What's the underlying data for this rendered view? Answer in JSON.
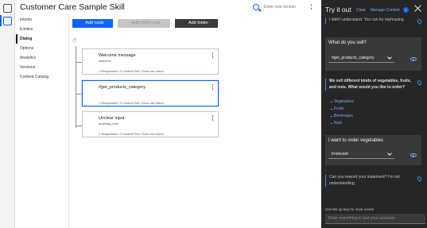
{
  "app": {
    "title": "Customer Care Sample Skill"
  },
  "header": {
    "version_placeholder": "Enter new version"
  },
  "nav": {
    "items": [
      {
        "label": "Intents"
      },
      {
        "label": "Entities"
      },
      {
        "label": "Dialog",
        "active": true
      },
      {
        "label": "Options"
      },
      {
        "label": "Analytics"
      },
      {
        "label": "Versions"
      },
      {
        "label": "Content Catalog"
      }
    ]
  },
  "toolbar": {
    "add_node": "Add node",
    "add_child_node": "Add child node",
    "add_folder": "Add folder"
  },
  "nodes": [
    {
      "title": "Welcome message",
      "condition": "welcome",
      "meta": "1 Responses / 0 Context Set / Does not return",
      "selected": false
    },
    {
      "title": "#get_products_category",
      "condition": "",
      "meta": "1 Responses / 0 Context Set / Does not return",
      "selected": true
    },
    {
      "title": "Unclear input",
      "condition": "anything_else",
      "meta": "1 Responses / 0 Context Set / Does not return",
      "selected": false
    }
  ],
  "panel": {
    "title": "Try it out",
    "clear": "Clear",
    "manage_context": "Manage Context",
    "context_count": "1",
    "messages": {
      "bot_1": "I didn't understand. You can try rephrasing.",
      "user_1": "What do you sell?",
      "user_1_intent": "#get_products_category",
      "bot_2": "We sell different kinds of vegetables, fruits, and nuts. What would you like to order?",
      "options": [
        "Vegetables",
        "Fruits",
        "Beverages",
        "Nuts"
      ],
      "user_2": "I want to order vegetables",
      "user_2_intent": "Irrelevant",
      "bot_3": "Can you reword your statement? I'm not understanding."
    },
    "hint": "Use the up key for most recent",
    "input_placeholder": "Enter something to test your assistant"
  },
  "colors": {
    "accent": "#0f62fe",
    "panel_bg": "#262626",
    "link": "#78a9ff"
  }
}
